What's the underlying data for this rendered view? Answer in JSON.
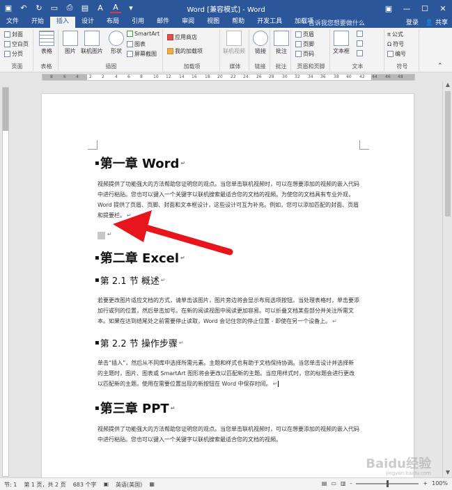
{
  "window": {
    "title": "Word [兼容模式] - Word"
  },
  "qat": {
    "icons": [
      "save-icon",
      "undo-icon",
      "redo-icon",
      "new-doc-icon",
      "print-icon",
      "layout-icon",
      "bold-a-icon",
      "font-color-icon",
      "customize-icon"
    ]
  },
  "tabs": [
    "文件",
    "开始",
    "插入",
    "设计",
    "布局",
    "引用",
    "邮件",
    "审阅",
    "视图",
    "帮助",
    "开发工具",
    "加载项"
  ],
  "active_tab": "插入",
  "tellme": {
    "icon": "lightbulb-icon",
    "placeholder": "告诉我您想要做什么"
  },
  "account": {
    "login": "登录",
    "share": "共享"
  },
  "ribbon": {
    "pages_group": {
      "label": "页面",
      "items": [
        "封面",
        "空白页",
        "分页"
      ]
    },
    "tables_group": {
      "label": "表格",
      "button": "表格"
    },
    "illustrations_group": {
      "label": "插图",
      "pictures": "图片",
      "online_pictures": "联机图片",
      "shapes": "形状",
      "smartart": "SmartArt",
      "chart": "图表",
      "screenshot": "屏幕截图"
    },
    "addins_group": {
      "label": "加载项",
      "store": "应用商店",
      "my_addins": "我的加载项"
    },
    "media_group": {
      "label": "媒体",
      "online_video": "联机视频"
    },
    "links_group": {
      "label": "链接",
      "button": "链接"
    },
    "comments_group": {
      "label": "批注",
      "button": "批注"
    },
    "header_footer_group": {
      "label": "页眉和页脚",
      "header": "页眉",
      "footer": "页脚",
      "page_number": "页码"
    },
    "text_group": {
      "label": "文本",
      "textbox": "文本框"
    },
    "symbols_group": {
      "label": "符号",
      "equation": "公式",
      "symbol": "符号",
      "number": "编号"
    }
  },
  "ruler": {
    "numbers": [
      "8",
      "6",
      "4",
      "2",
      "2",
      "4",
      "6",
      "8",
      "10",
      "12",
      "14",
      "16",
      "18",
      "20",
      "22",
      "24",
      "26",
      "28",
      "30",
      "32",
      "34",
      "36",
      "38",
      "40",
      "42",
      "44",
      "46",
      "48"
    ]
  },
  "document": {
    "h1_1": "第一章 Word",
    "para1": "视频提供了功能强大的方法帮助您证明您的观点。当您单击联机视频时，可以在想要添加的视频的嵌入代码中进行粘贴。您也可以键入一个关键字以联机搜索最适合您的文档的视频。为使您的文档具有专业外观，Word 提供了页眉、页脚、封面和文本框设计，这些设计可互为补充。例如，您可以添加匹配的封面、页眉和提要栏。",
    "h1_2": "第二章 Excel",
    "h2_1": "第 2.1 节 概述",
    "para2": "若要更改图片适应文档的方式，请单击该图片，图片旁边将会显示布局选项按钮。当处理表格时，单击要添加行或列的位置，然后单击加号。在新的阅读视图中阅读更加容易。可以折叠文档某些部分并关注所需文本。如果在达到结尾处之前需要停止读取，Word 会记住您的停止位置 - 即使在另一个设备上。",
    "h2_2": "第 2.2 节 操作步骤",
    "para3": "单击“插入”，然后从不同库中选择所需元素。主题和样式也有助于文档保持协调。当您单击设计并选择新的主题时，图片、图表或 SmartArt 图形将会更改以匹配新的主题。当应用样式时，您的标题会进行更改以匹配新的主题。使用在需要位置出现的新按钮在 Word 中保存时间。",
    "h1_3": "第三章 PPT",
    "para4": "视频提供了功能强大的方法帮助您证明您的观点。当您单击联机视频时，可以在想要添加的视频的嵌入代码中进行粘贴。您也可以键入一个关键字以联机搜索最适合您的文档的视频。"
  },
  "status": {
    "section": "节: 1",
    "page": "第 1 页，共 2 页",
    "words": "683 个字",
    "language": "英语(美国)",
    "zoom": "100%",
    "zoom_minus": "-",
    "zoom_plus": "+"
  },
  "watermark": {
    "text": "Baidu经验",
    "sub": "jingyan.baidu.com"
  },
  "colors": {
    "accent": "#2b579a",
    "arrow": "#e8161c",
    "ribbon_bg": "#f3f3f3"
  }
}
